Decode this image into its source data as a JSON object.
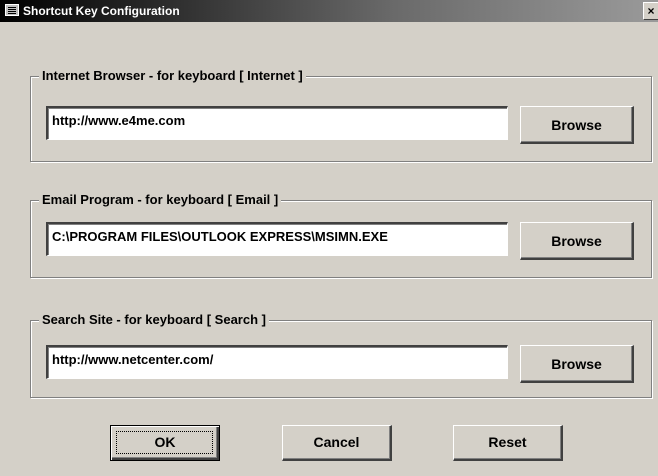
{
  "window": {
    "title": "Shortcut Key Configuration",
    "close_glyph": "×"
  },
  "groups": [
    {
      "legend": "Internet Browser - for keyboard [ Internet ]",
      "value": "http://www.e4me.com",
      "browse_label": "Browse"
    },
    {
      "legend": "Email Program - for keyboard [ Email ]",
      "value": "C:\\PROGRAM FILES\\OUTLOOK EXPRESS\\MSIMN.EXE",
      "browse_label": "Browse"
    },
    {
      "legend": "Search Site - for keyboard [ Search ]",
      "value": "http://www.netcenter.com/",
      "browse_label": "Browse"
    }
  ],
  "buttons": {
    "ok": "OK",
    "cancel": "Cancel",
    "reset": "Reset"
  },
  "icons": {
    "app": "keyboard-icon",
    "close": "close-icon"
  },
  "colors": {
    "dialog_face": "#d4d0c8",
    "titlebar_start": "#000000",
    "titlebar_end": "#9a9a9a"
  }
}
